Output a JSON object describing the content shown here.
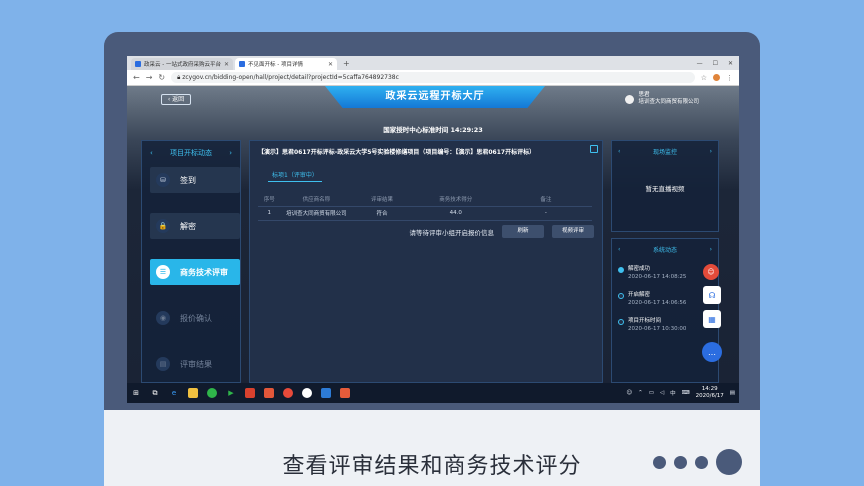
{
  "browser": {
    "tabs": [
      {
        "label": "政采云 - 一站式政府采购云平台",
        "active": false
      },
      {
        "label": "不见面开标 - 项目详情",
        "active": true
      }
    ],
    "url": "zcygov.cn/bidding-open/hall/project/detail?projectId=5caffa764892738c"
  },
  "page": {
    "back_label": "返回",
    "banner_title": "政采云远程开标大厅",
    "user_name": "思君",
    "user_company": "培训查大同商贸有限公司",
    "center_time": "国家授时中心标准时间 14:29:23"
  },
  "left_panel": {
    "title": "项目开标动态",
    "steps": [
      {
        "label": "签到",
        "state": "done",
        "icon": "⛁"
      },
      {
        "label": "解密",
        "state": "done",
        "icon": "🔒"
      },
      {
        "label": "商务技术评审",
        "state": "active",
        "icon": "☰"
      },
      {
        "label": "报价确认",
        "state": "pending",
        "icon": "◉"
      },
      {
        "label": "评审结果",
        "state": "pending",
        "icon": "▤"
      }
    ]
  },
  "center_panel": {
    "project": "【演示】思君0617开标评标-政采云大学5号实验楼修缮项目（项目编号：【演示】思君0617开标评标）",
    "subtab": "标项1（评审中）",
    "table": {
      "headers": [
        "序号",
        "供应商名称",
        "评审结果",
        "商务技术得分",
        "备注"
      ],
      "rows": [
        [
          "1",
          "培训查大同商贸有限公司",
          "符合",
          "44.0",
          "-"
        ]
      ]
    },
    "waiting_msg": "请等待评审小组开启报价信息",
    "btn_refresh": "刷新",
    "btn_video": "视频评审"
  },
  "right_panel": {
    "monitor_title": "现场监控",
    "no_video": "暂无直播视频",
    "dynamics_title": "系统动态",
    "events": [
      {
        "label": "解密成功",
        "time": "2020-06-17 14:08:25"
      },
      {
        "label": "开启解密",
        "time": "2020-06-17 14:06:56"
      },
      {
        "label": "项目开标时间",
        "time": "2020-06-17 10:30:00"
      }
    ]
  },
  "taskbar": {
    "ime": "中",
    "time": "14:29",
    "date": "2020/6/17"
  },
  "caption": "查看评审结果和商务技术评分"
}
